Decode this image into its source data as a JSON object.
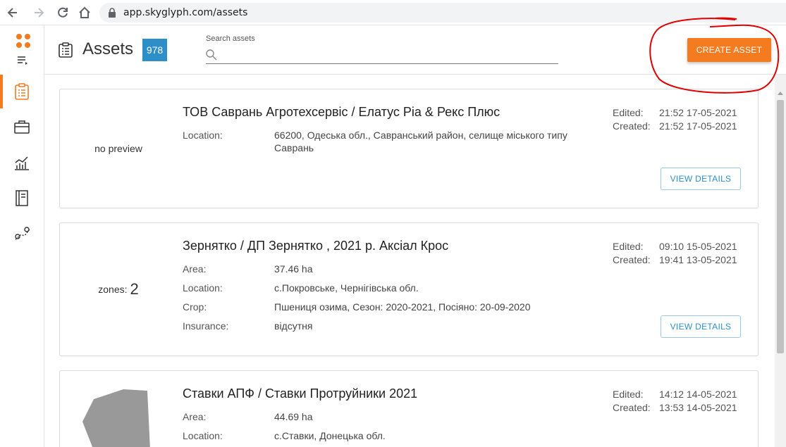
{
  "browser": {
    "url": "app.skyglyph.com/assets"
  },
  "header": {
    "title": "Assets",
    "count": "978",
    "search_label": "Search assets",
    "search_value": "",
    "create_button": "CREATE ASSET"
  },
  "sidebar": {
    "items": [
      {
        "name": "assets",
        "icon": "clipboard-icon",
        "active": true
      },
      {
        "name": "portfolio",
        "icon": "briefcase-icon",
        "active": false
      },
      {
        "name": "analytics",
        "icon": "chart-icon",
        "active": false
      },
      {
        "name": "reports",
        "icon": "notebook-icon",
        "active": false
      },
      {
        "name": "map",
        "icon": "route-icon",
        "active": false
      }
    ]
  },
  "assets": [
    {
      "preview": "no preview",
      "title": "ТОВ Саврань Агротехсервіс / Елатус Ріа & Рекс Плюс",
      "fields": [
        {
          "label": "Location:",
          "value": "66200, Одеська обл., Савранський район, селище міського типу Саврань"
        }
      ],
      "edited_label": "Edited:",
      "edited": "21:52 17-05-2021",
      "created_label": "Created:",
      "created": "21:52 17-05-2021",
      "button": "VIEW DETAILS"
    },
    {
      "preview_label": "zones:",
      "preview_count": "2",
      "title": "Зернятко / ДП Зернятко , 2021 р. Аксіал Крос",
      "fields": [
        {
          "label": "Area:",
          "value": "37.46 ha"
        },
        {
          "label": "Location:",
          "value": "с.Покровське, Чернігівська обл."
        },
        {
          "label": "Crop:",
          "value": "Пшениця озима, Сезон: 2020-2021, Посіяно: 20-09-2020"
        },
        {
          "label": "Insurance:",
          "value": "відсутня"
        }
      ],
      "edited_label": "Edited:",
      "edited": "09:10 15-05-2021",
      "created_label": "Created:",
      "created": "19:41 13-05-2021",
      "button": "VIEW DETAILS"
    },
    {
      "title": "Ставки АПФ / Ставки Протруйники 2021",
      "fields": [
        {
          "label": "Area:",
          "value": "44.69 ha"
        },
        {
          "label": "Location:",
          "value": "с.Ставки, Донецька обл."
        }
      ],
      "edited_label": "Edited:",
      "edited": "14:12 14-05-2021",
      "created_label": "Created:",
      "created": "13:53 14-05-2021"
    }
  ],
  "colors": {
    "accent": "#f47b20",
    "badge": "#2e8fc8",
    "annotation": "#e00000"
  }
}
